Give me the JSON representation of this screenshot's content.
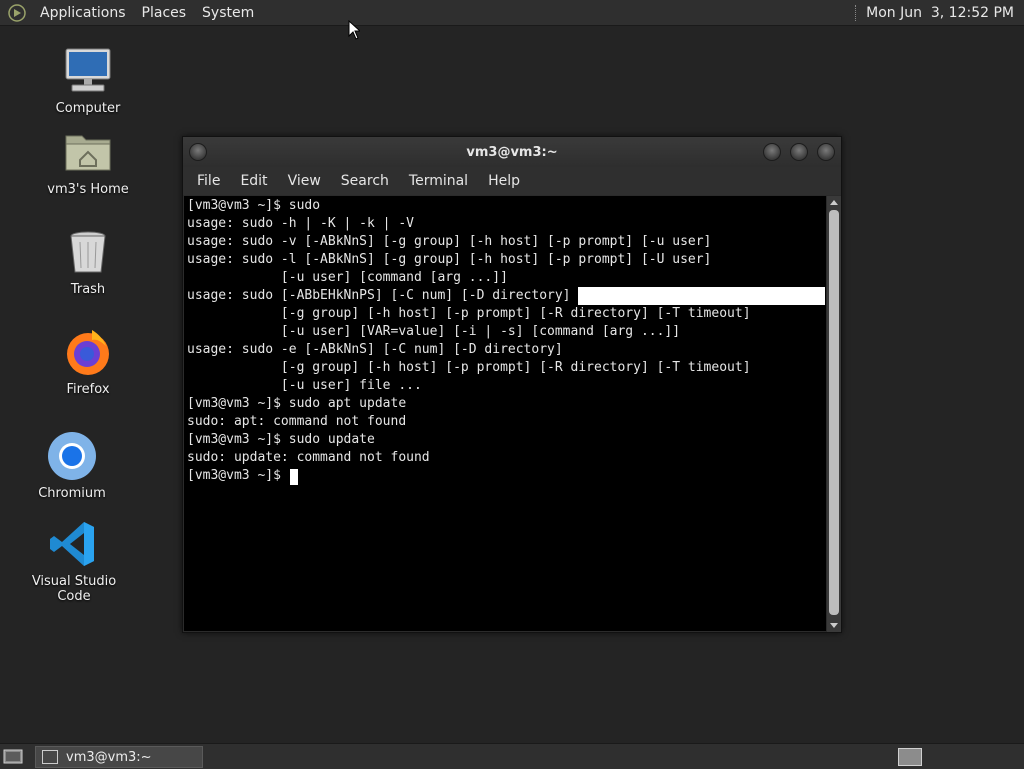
{
  "top_panel": {
    "menus": [
      "Applications",
      "Places",
      "System"
    ],
    "clock": "Mon Jun  3, 12:52 PM"
  },
  "desktop_icons": [
    {
      "label": "Computer",
      "icon": "computer-icon"
    },
    {
      "label": "vm3's Home",
      "icon": "home-folder-icon"
    },
    {
      "label": "Trash",
      "icon": "trash-icon"
    },
    {
      "label": "Firefox",
      "icon": "firefox-icon"
    },
    {
      "label": "Chromium",
      "icon": "chromium-icon"
    },
    {
      "label": "Visual Studio Code",
      "icon": "vscode-icon"
    }
  ],
  "terminal": {
    "title": "vm3@vm3:~",
    "menu": [
      "File",
      "Edit",
      "View",
      "Search",
      "Terminal",
      "Help"
    ],
    "lines": [
      "[vm3@vm3 ~]$ sudo",
      "usage: sudo -h | -K | -k | -V",
      "usage: sudo -v [-ABkNnS] [-g group] [-h host] [-p prompt] [-u user]",
      "usage: sudo -l [-ABkNnS] [-g group] [-h host] [-p prompt] [-U user]",
      "            [-u user] [command [arg ...]]",
      "usage: sudo [-ABbEHkNnPS] [-C num] [-D directory]",
      "            [-g group] [-h host] [-p prompt] [-R directory] [-T timeout]",
      "            [-u user] [VAR=value] [-i | -s] [command [arg ...]]",
      "usage: sudo -e [-ABkNnS] [-C num] [-D directory]",
      "            [-g group] [-h host] [-p prompt] [-R directory] [-T timeout]",
      "            [-u user] file ...",
      "[vm3@vm3 ~]$ sudo apt update",
      "sudo: apt: command not found",
      "[vm3@vm3 ~]$ sudo update",
      "sudo: update: command not found",
      "[vm3@vm3 ~]$ "
    ]
  },
  "taskbar": {
    "items": [
      {
        "label": "vm3@vm3:~"
      }
    ]
  }
}
